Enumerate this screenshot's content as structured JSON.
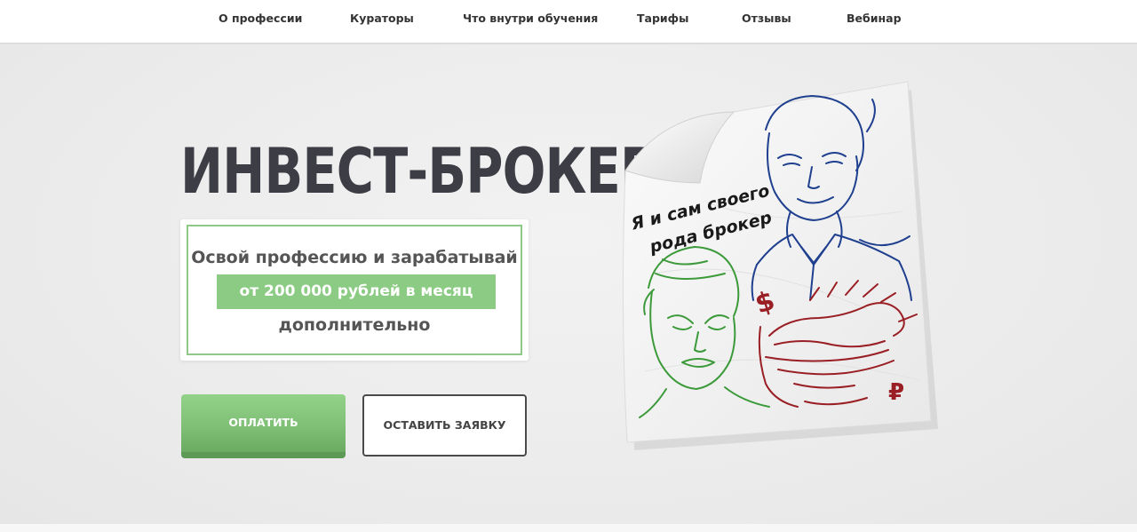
{
  "nav": {
    "items": [
      {
        "label": "О профессии"
      },
      {
        "label": "Кураторы"
      },
      {
        "label": "Что внутри обучения"
      },
      {
        "label": "Тарифы"
      },
      {
        "label": "Отзывы"
      },
      {
        "label": "Вебинар"
      }
    ]
  },
  "hero": {
    "title": "ИНВЕСТ-БРОКЕР",
    "offer": {
      "line1": "Освой профессию и зарабатывай",
      "highlight": "от 200 000 рублей в месяц",
      "line3": "дополнительно"
    },
    "buttons": {
      "pay": "ОПЛАТИТЬ",
      "request": "ОСТАВИТЬ ЗАЯВКУ"
    }
  },
  "illustration": {
    "caption_line1": "Я и сам своего",
    "caption_line2": "рода брокер",
    "symbol_dollar": "$",
    "symbol_ruble": "₽"
  },
  "colors": {
    "accent_green": "#8ccb83",
    "title_dark": "#3d3d45",
    "sketch_blue": "#1f3f8f",
    "sketch_green": "#3c9a3a",
    "sketch_red": "#9a1f24"
  }
}
